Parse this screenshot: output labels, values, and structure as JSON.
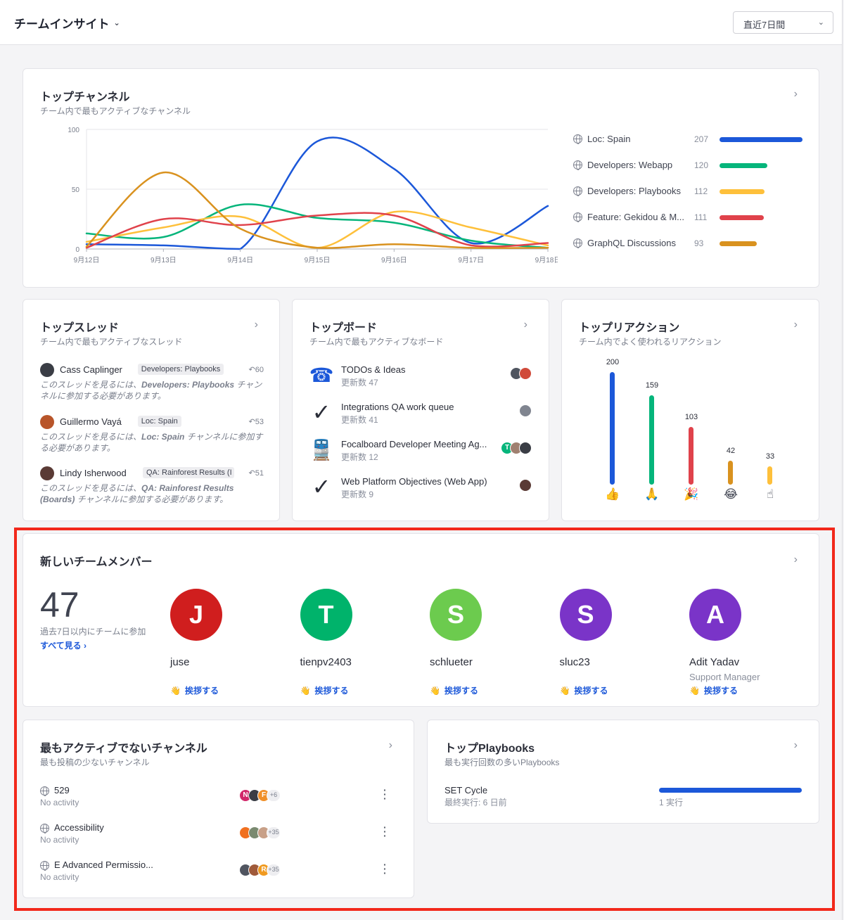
{
  "header": {
    "title": "チームインサイト",
    "range": "直近7日間"
  },
  "top_channels": {
    "title": "トップチャンネル",
    "subtitle": "チーム内で最もアクティブなチャンネル",
    "legend": [
      {
        "name": "Loc: Spain",
        "value": "207",
        "color": "#1c58d9"
      },
      {
        "name": "Developers: Webapp",
        "value": "120",
        "color": "#06b57b"
      },
      {
        "name": "Developers: Playbooks",
        "value": "112",
        "color": "#fec03b"
      },
      {
        "name": "Feature: Gekidou & M...",
        "value": "111",
        "color": "#e0424b"
      },
      {
        "name": "GraphQL Discussions",
        "value": "93",
        "color": "#d9921f"
      }
    ]
  },
  "chart_data": {
    "type": "line",
    "x": [
      "9月12日",
      "9月13日",
      "9月14日",
      "9月15日",
      "9月16日",
      "9月17日",
      "9月18日"
    ],
    "ylim": [
      0,
      100
    ],
    "yticks": [
      "0",
      "50",
      "100"
    ],
    "series": [
      {
        "name": "Loc: Spain",
        "color": "#1c58d9",
        "values": [
          4,
          3,
          0,
          90,
          67,
          5,
          36
        ]
      },
      {
        "name": "Developers: Webapp",
        "color": "#06b57b",
        "values": [
          13,
          10,
          37,
          26,
          22,
          7,
          1
        ]
      },
      {
        "name": "Developers: Playbooks",
        "color": "#fec03b",
        "values": [
          6,
          18,
          27,
          1,
          31,
          18,
          3
        ]
      },
      {
        "name": "Feature: Gekidou & M...",
        "color": "#e0424b",
        "values": [
          1,
          25,
          20,
          28,
          28,
          3,
          5
        ]
      },
      {
        "name": "GraphQL Discussions",
        "color": "#d9921f",
        "values": [
          2,
          64,
          17,
          1,
          4,
          1,
          1
        ]
      }
    ]
  },
  "top_threads": {
    "title": "トップスレッド",
    "subtitle": "チーム内で最もアクティブなスレッド",
    "items": [
      {
        "name": "Cass Caplinger",
        "channel": "Developers: Playbooks",
        "replies": "60",
        "msg_pre": "このスレッドを見るには、",
        "msg_channel": "Developers: Playbooks",
        "msg_post": " チャンネルに参加する必要があります。",
        "avatar_color": "#3a3d45"
      },
      {
        "name": "Guillermo Vayá",
        "channel": "Loc: Spain",
        "replies": "53",
        "msg_pre": "このスレッドを見るには、",
        "msg_channel": "Loc: Spain",
        "msg_post": " チャンネルに参加する必要があります。",
        "avatar_color": "#b8552a"
      },
      {
        "name": "Lindy Isherwood",
        "channel": "QA: Rainforest Results (I",
        "replies": "51",
        "msg_pre": "このスレッドを見るには、",
        "msg_channel": "QA: Rainforest Results (Boards)",
        "msg_post": " チャンネルに参加する必要があります。",
        "avatar_color": "#5a3a35"
      }
    ]
  },
  "top_boards": {
    "title": "トップボード",
    "subtitle": "チーム内で最もアクティブなボード",
    "items": [
      {
        "name": "TODOs & Ideas",
        "updates": "更新数 47",
        "icon": "telephone-icon"
      },
      {
        "name": "Integrations QA work queue",
        "updates": "更新数 41",
        "icon": "checkmark-icon"
      },
      {
        "name": "Focalboard Developer Meeting Ag...",
        "updates": "更新数 12",
        "icon": "train-icon"
      },
      {
        "name": "Web Platform Objectives (Web App)",
        "updates": "更新数 9",
        "icon": "checkmark-icon"
      }
    ]
  },
  "top_reactions": {
    "title": "トップリアクション",
    "subtitle": "チーム内でよく使われるリアクション",
    "items": [
      {
        "count": 200,
        "label": "200",
        "emoji": "👍",
        "color": "#1c58d9"
      },
      {
        "count": 159,
        "label": "159",
        "emoji": "🙏",
        "color": "#06b57b"
      },
      {
        "count": 103,
        "label": "103",
        "emoji": "🎉",
        "color": "#e0424b"
      },
      {
        "count": 42,
        "label": "42",
        "emoji": "😂",
        "color": "#d9921f"
      },
      {
        "count": 33,
        "label": "33",
        "emoji": "☝",
        "color": "#fec03b"
      }
    ]
  },
  "new_members": {
    "title": "新しいチームメンバー",
    "count": "47",
    "caption": "過去7日以内にチームに参加",
    "see_all": "すべて見る ›",
    "wave_label": "挨拶する",
    "members": [
      {
        "initial": "J",
        "name": "juse",
        "role": "",
        "color": "#d01e1e"
      },
      {
        "initial": "T",
        "name": "tienpv2403",
        "role": "",
        "color": "#00b36b"
      },
      {
        "initial": "S",
        "name": "schlueter",
        "role": "",
        "color": "#6ccb4e"
      },
      {
        "initial": "S",
        "name": "sluc23",
        "role": "",
        "color": "#7a34c8"
      },
      {
        "initial": "A",
        "name": "Adit Yadav",
        "role": "Support Manager",
        "color": "#7a34c8"
      }
    ]
  },
  "least_active": {
    "title": "最もアクティブでないチャンネル",
    "subtitle": "最も投稿の少ないチャンネル",
    "items": [
      {
        "name": "529",
        "activity": "No activity",
        "extra": "+6",
        "avatars": [
          "N",
          "",
          "F"
        ],
        "colors": [
          "#d1286a",
          "#3a3d45",
          "#f0902a"
        ]
      },
      {
        "name": "Accessibility",
        "activity": "No activity",
        "extra": "+35",
        "avatars": [
          "",
          "",
          ""
        ],
        "colors": [
          "#f07020",
          "#7a8a70",
          "#c8a088"
        ]
      },
      {
        "name": "E Advanced Permissio...",
        "activity": "No activity",
        "extra": "+35",
        "avatars": [
          "",
          "",
          "R"
        ],
        "colors": [
          "#505560",
          "#a05a3a",
          "#f09a20"
        ]
      }
    ]
  },
  "top_playbooks": {
    "title": "トップPlaybooks",
    "subtitle": "最も実行回数の多いPlaybooks",
    "items": [
      {
        "name": "SET Cycle",
        "last_run": "最終実行: 6 日前",
        "runs": "1 実行",
        "progress": 1.0,
        "color": "#1c58d9"
      }
    ]
  }
}
